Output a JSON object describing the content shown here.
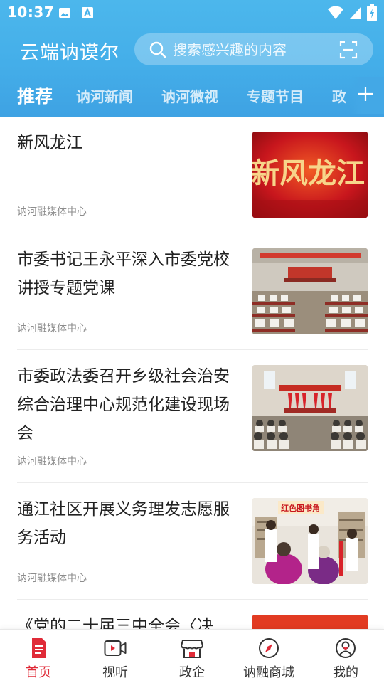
{
  "status_bar": {
    "time": "10:37"
  },
  "header": {
    "app_title": "云端讷谟尔",
    "search_placeholder": "搜索感兴趣的内容"
  },
  "tabs": [
    {
      "label": "推荐",
      "active": true
    },
    {
      "label": "讷河新闻",
      "active": false
    },
    {
      "label": "讷河微视",
      "active": false
    },
    {
      "label": "专题节目",
      "active": false
    },
    {
      "label": "政",
      "active": false
    }
  ],
  "feed": [
    {
      "title": "新风龙江",
      "source": "讷河融媒体中心",
      "thumb_text": "新风龙江"
    },
    {
      "title": "市委书记王永平深入市委党校讲授专题党课",
      "source": "讷河融媒体中心"
    },
    {
      "title": "市委政法委召开乡级社会治安综合治理中心规范化建设现场会",
      "source": "讷河融媒体中心"
    },
    {
      "title": "通江社区开展义务理发志愿服务活动",
      "source": "讷河融媒体中心",
      "thumb_text": "红色图书角"
    },
    {
      "title": "《党的二十届三中全会〈决",
      "source": ""
    }
  ],
  "bottom_nav": [
    {
      "label": "首页",
      "icon": "home-doc-icon",
      "active": true
    },
    {
      "label": "视听",
      "icon": "video-icon",
      "active": false
    },
    {
      "label": "政企",
      "icon": "store-icon",
      "active": false
    },
    {
      "label": "讷融商城",
      "icon": "compass-icon",
      "active": false
    },
    {
      "label": "我的",
      "icon": "user-icon",
      "active": false
    }
  ],
  "colors": {
    "header_blue": "#46b1ea",
    "accent_red": "#e02b38"
  }
}
